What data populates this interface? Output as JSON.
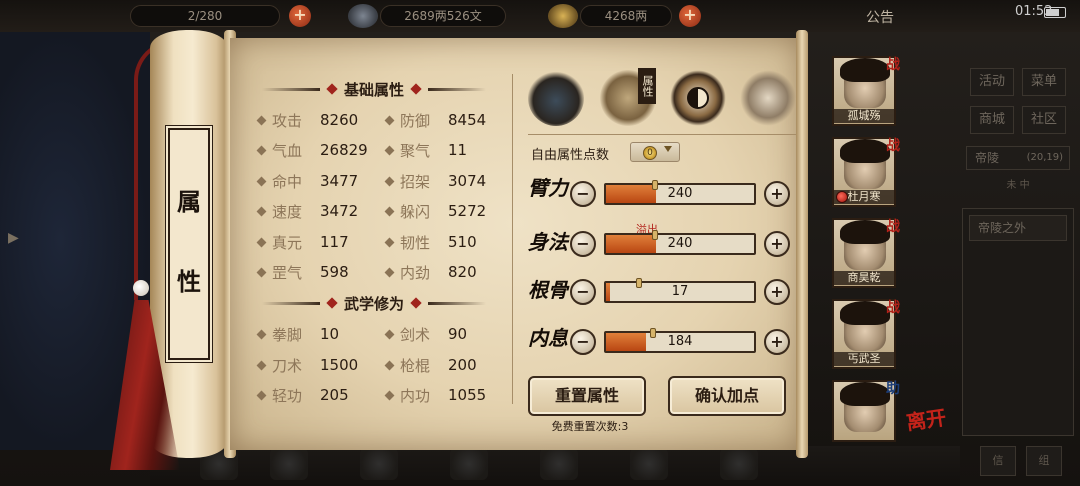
{
  "topbar": {
    "capacity_partial": "2/280",
    "copper": "2689两526文",
    "silver": "4268两",
    "notice_label": "公告",
    "time": "01:52"
  },
  "side_menu": {
    "buttons": [
      "活动",
      "菜单",
      "商城",
      "社区"
    ],
    "location": "帝陵",
    "coords": "(20,19)",
    "sublabel": "未 中",
    "panel_item": "帝陵之外"
  },
  "bottom_small": [
    "信",
    "组"
  ],
  "scroll_title": [
    "属",
    "性"
  ],
  "basic": {
    "heading": "基础属性",
    "stats": [
      {
        "label": "攻击",
        "value": "8260"
      },
      {
        "label": "防御",
        "value": "8454"
      },
      {
        "label": "气血",
        "value": "26829"
      },
      {
        "label": "聚气",
        "value": "11"
      },
      {
        "label": "命中",
        "value": "3477"
      },
      {
        "label": "招架",
        "value": "3074"
      },
      {
        "label": "速度",
        "value": "3472"
      },
      {
        "label": "躲闪",
        "value": "5272"
      },
      {
        "label": "真元",
        "value": "117"
      },
      {
        "label": "韧性",
        "value": "510"
      },
      {
        "label": "罡气",
        "value": "598"
      },
      {
        "label": "内劲",
        "value": "820"
      }
    ]
  },
  "martial": {
    "heading": "武学修为",
    "stats": [
      {
        "label": "拳脚",
        "value": "10"
      },
      {
        "label": "剑术",
        "value": "90"
      },
      {
        "label": "刀术",
        "value": "1500"
      },
      {
        "label": "枪棍",
        "value": "200"
      },
      {
        "label": "轻功",
        "value": "205"
      },
      {
        "label": "内功",
        "value": "1055"
      }
    ]
  },
  "tabs": {
    "selected_tag": "属性"
  },
  "free_points": {
    "label": "自由属性点数",
    "value": "0"
  },
  "points": [
    {
      "name": "臂力",
      "value": "240",
      "fill_fraction": 0.34
    },
    {
      "name": "身法",
      "value": "240",
      "fill_fraction": 0.34,
      "note": "溢出"
    },
    {
      "name": "根骨",
      "value": "17",
      "fill_fraction": 0.03
    },
    {
      "name": "内息",
      "value": "184",
      "fill_fraction": 0.27
    }
  ],
  "buttons": {
    "reset": "重置属性",
    "confirm": "确认加点",
    "reset_note": "免费重置次数:3"
  },
  "party": [
    {
      "name": "孤城殇",
      "tag": "战"
    },
    {
      "name": "杜月寒",
      "tag": "战"
    },
    {
      "name": "商昊乾",
      "tag": "战"
    },
    {
      "name": "丐武圣",
      "tag": "战"
    },
    {
      "name": "",
      "tag": "助"
    }
  ],
  "leave_label": "离开"
}
